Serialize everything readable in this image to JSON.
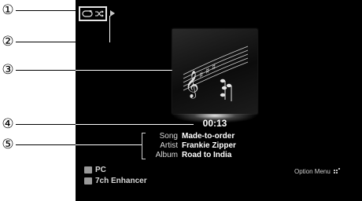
{
  "callouts": [
    "①",
    "②",
    "③",
    "④",
    "⑤"
  ],
  "playback": {
    "repeat_icon": "repeat-icon",
    "shuffle_icon": "shuffle-icon",
    "status_icon": "play-icon"
  },
  "album_art": {
    "icon": "music-score-icon"
  },
  "time": "00:13",
  "info": [
    {
      "label": "Song",
      "value": "Made-to-order"
    },
    {
      "label": "Artist",
      "value": "Frankie Zipper"
    },
    {
      "label": "Album",
      "value": "Road to India"
    }
  ],
  "source": {
    "input": "PC",
    "dsp": "7ch Enhancer",
    "input_icon": "input-icon",
    "dsp_icon": "dsp-icon"
  },
  "option_menu": {
    "label": "Option Menu",
    "icon": "option-icon"
  },
  "colors": {
    "screen_bg": "#000000",
    "text": "#ffffff",
    "label": "#d8d8d8"
  }
}
